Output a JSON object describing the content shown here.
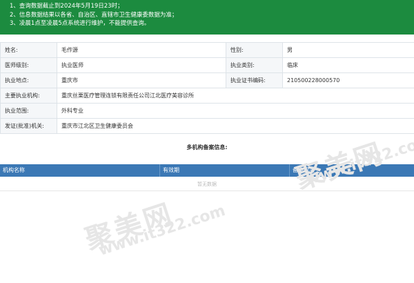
{
  "notice": {
    "lines": [
      "1、查询数据截止到2024年5月19日23时；",
      "2、信息数据结果以各省、自治区、直辖市卫生健康委数据为准；",
      "3、凌晨1点至凌晨5点系统进行维护，不能提供查询。"
    ]
  },
  "info": {
    "name_label": "姓名:",
    "name_value": "毛作源",
    "gender_label": "性别:",
    "gender_value": "男",
    "level_label": "医师级别:",
    "level_value": "执业医师",
    "category_label": "执业类别:",
    "category_value": "临床",
    "location_label": "执业地点:",
    "location_value": "重庆市",
    "cert_label": "执业证书编码:",
    "cert_value": "210500228000570",
    "org_label": "主要执业机构:",
    "org_value": "重庆丝栗医疗管理连锁有限责任公司江北医疗美容诊所",
    "scope_label": "执业范围:",
    "scope_value": "外科专业",
    "issuer_label": "发证(批准)机关:",
    "issuer_value": "重庆市江北区卫生健康委员会"
  },
  "multi": {
    "title": "多机构备案信息:",
    "columns": [
      "机构名称",
      "有效期",
      "备案机关"
    ],
    "empty_text": "暂无数据"
  },
  "watermark": {
    "brand": "聚美网",
    "url": "www.it322.com"
  }
}
